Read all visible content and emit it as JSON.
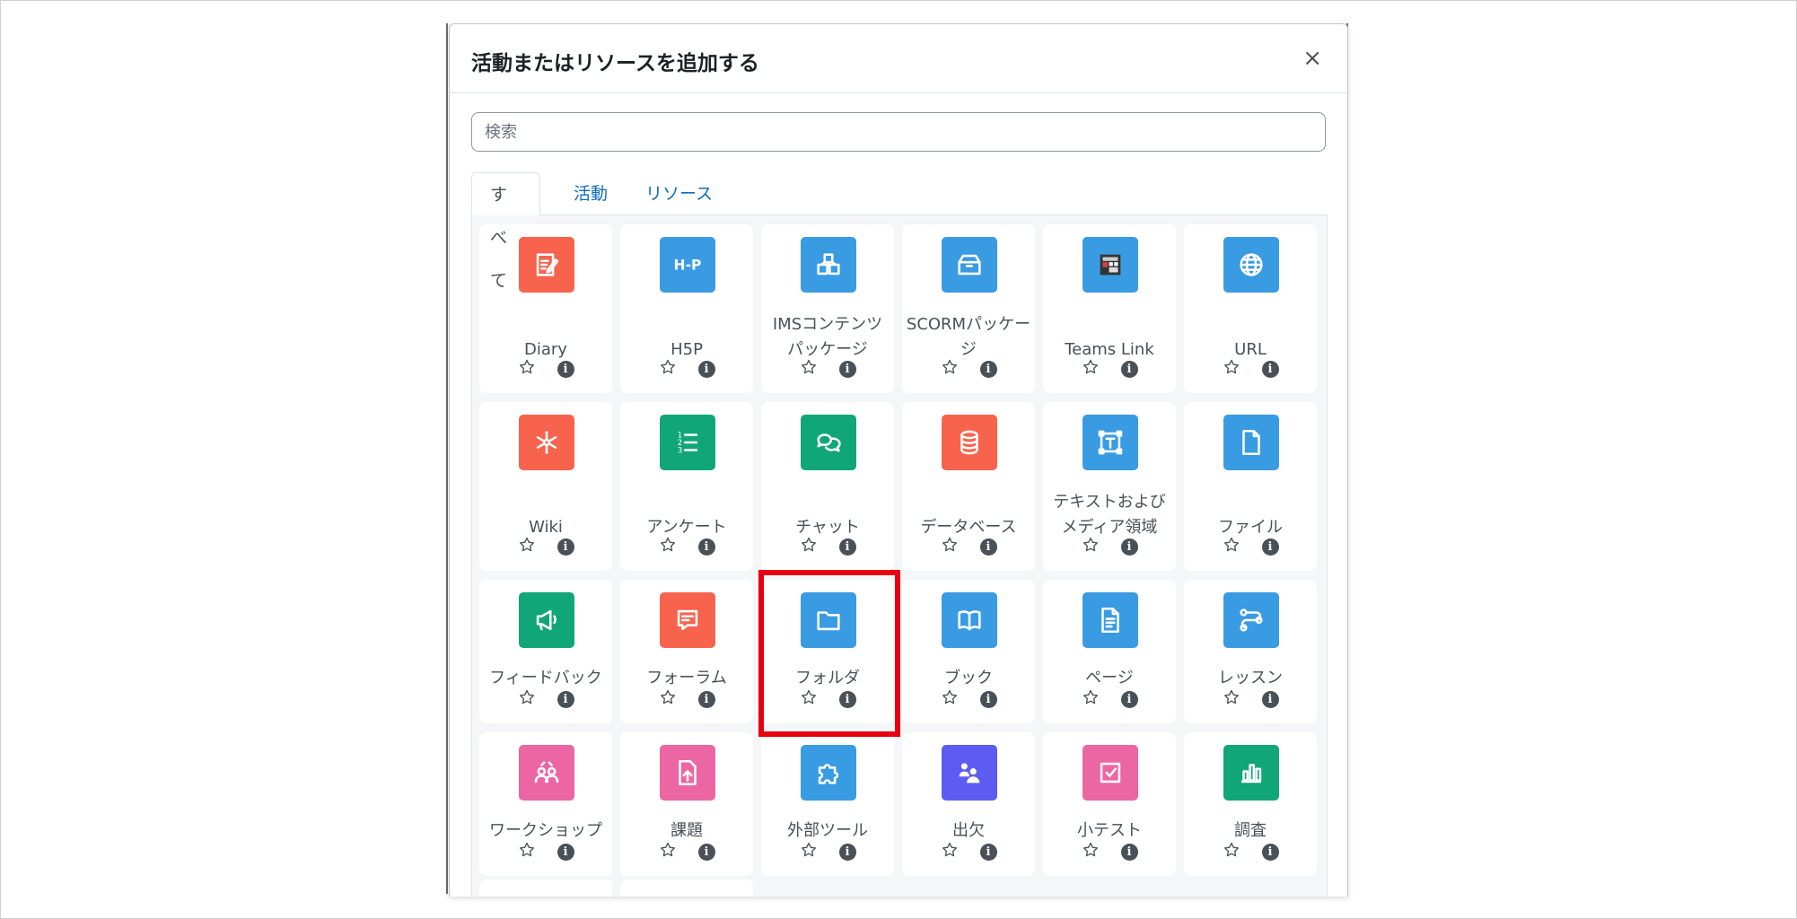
{
  "modal": {
    "title": "活動またはリソースを追加する",
    "close": "×"
  },
  "search": {
    "placeholder": "検索"
  },
  "tabs": [
    "すべて",
    "活動",
    "リソース"
  ],
  "colors": {
    "red": "#f7634d",
    "blue": "#399be2",
    "green": "#11a676",
    "pink": "#eb66a2",
    "purple": "#5c5cf2",
    "highlight": "#e6000f",
    "link": "#0f6cbf"
  },
  "items": [
    {
      "label": "Diary",
      "icon": "diary-icon",
      "color": "red"
    },
    {
      "label": "H5P",
      "icon": "h5p-icon",
      "color": "blue"
    },
    {
      "label": "IMSコンテンツパッケージ",
      "icon": "ims-package-icon",
      "color": "blue"
    },
    {
      "label": "SCORMパッケージ",
      "icon": "scorm-package-icon",
      "color": "blue"
    },
    {
      "label": "Teams Link",
      "icon": "teams-link-icon",
      "color": "blue"
    },
    {
      "label": "URL",
      "icon": "globe-icon",
      "color": "blue"
    },
    {
      "label": "Wiki",
      "icon": "wiki-icon",
      "color": "red"
    },
    {
      "label": "アンケート",
      "icon": "questionnaire-icon",
      "color": "green"
    },
    {
      "label": "チャット",
      "icon": "chat-icon",
      "color": "green"
    },
    {
      "label": "データベース",
      "icon": "database-icon",
      "color": "red"
    },
    {
      "label": "テキストおよびメディア領域",
      "icon": "text-media-icon",
      "color": "blue"
    },
    {
      "label": "ファイル",
      "icon": "file-icon",
      "color": "blue"
    },
    {
      "label": "フィードバック",
      "icon": "feedback-icon",
      "color": "green"
    },
    {
      "label": "フォーラム",
      "icon": "forum-icon",
      "color": "red"
    },
    {
      "label": "フォルダ",
      "icon": "folder-icon",
      "color": "blue"
    },
    {
      "label": "ブック",
      "icon": "book-icon",
      "color": "blue"
    },
    {
      "label": "ページ",
      "icon": "page-icon",
      "color": "blue"
    },
    {
      "label": "レッスン",
      "icon": "lesson-icon",
      "color": "blue"
    },
    {
      "label": "ワークショップ",
      "icon": "workshop-icon",
      "color": "pink"
    },
    {
      "label": "課題",
      "icon": "assignment-icon",
      "color": "pink"
    },
    {
      "label": "外部ツール",
      "icon": "puzzle-icon",
      "color": "blue"
    },
    {
      "label": "出欠",
      "icon": "attendance-icon",
      "color": "purple"
    },
    {
      "label": "小テスト",
      "icon": "quiz-icon",
      "color": "pink"
    },
    {
      "label": "調査",
      "icon": "survey-icon",
      "color": "green"
    }
  ],
  "info_glyph": "i"
}
